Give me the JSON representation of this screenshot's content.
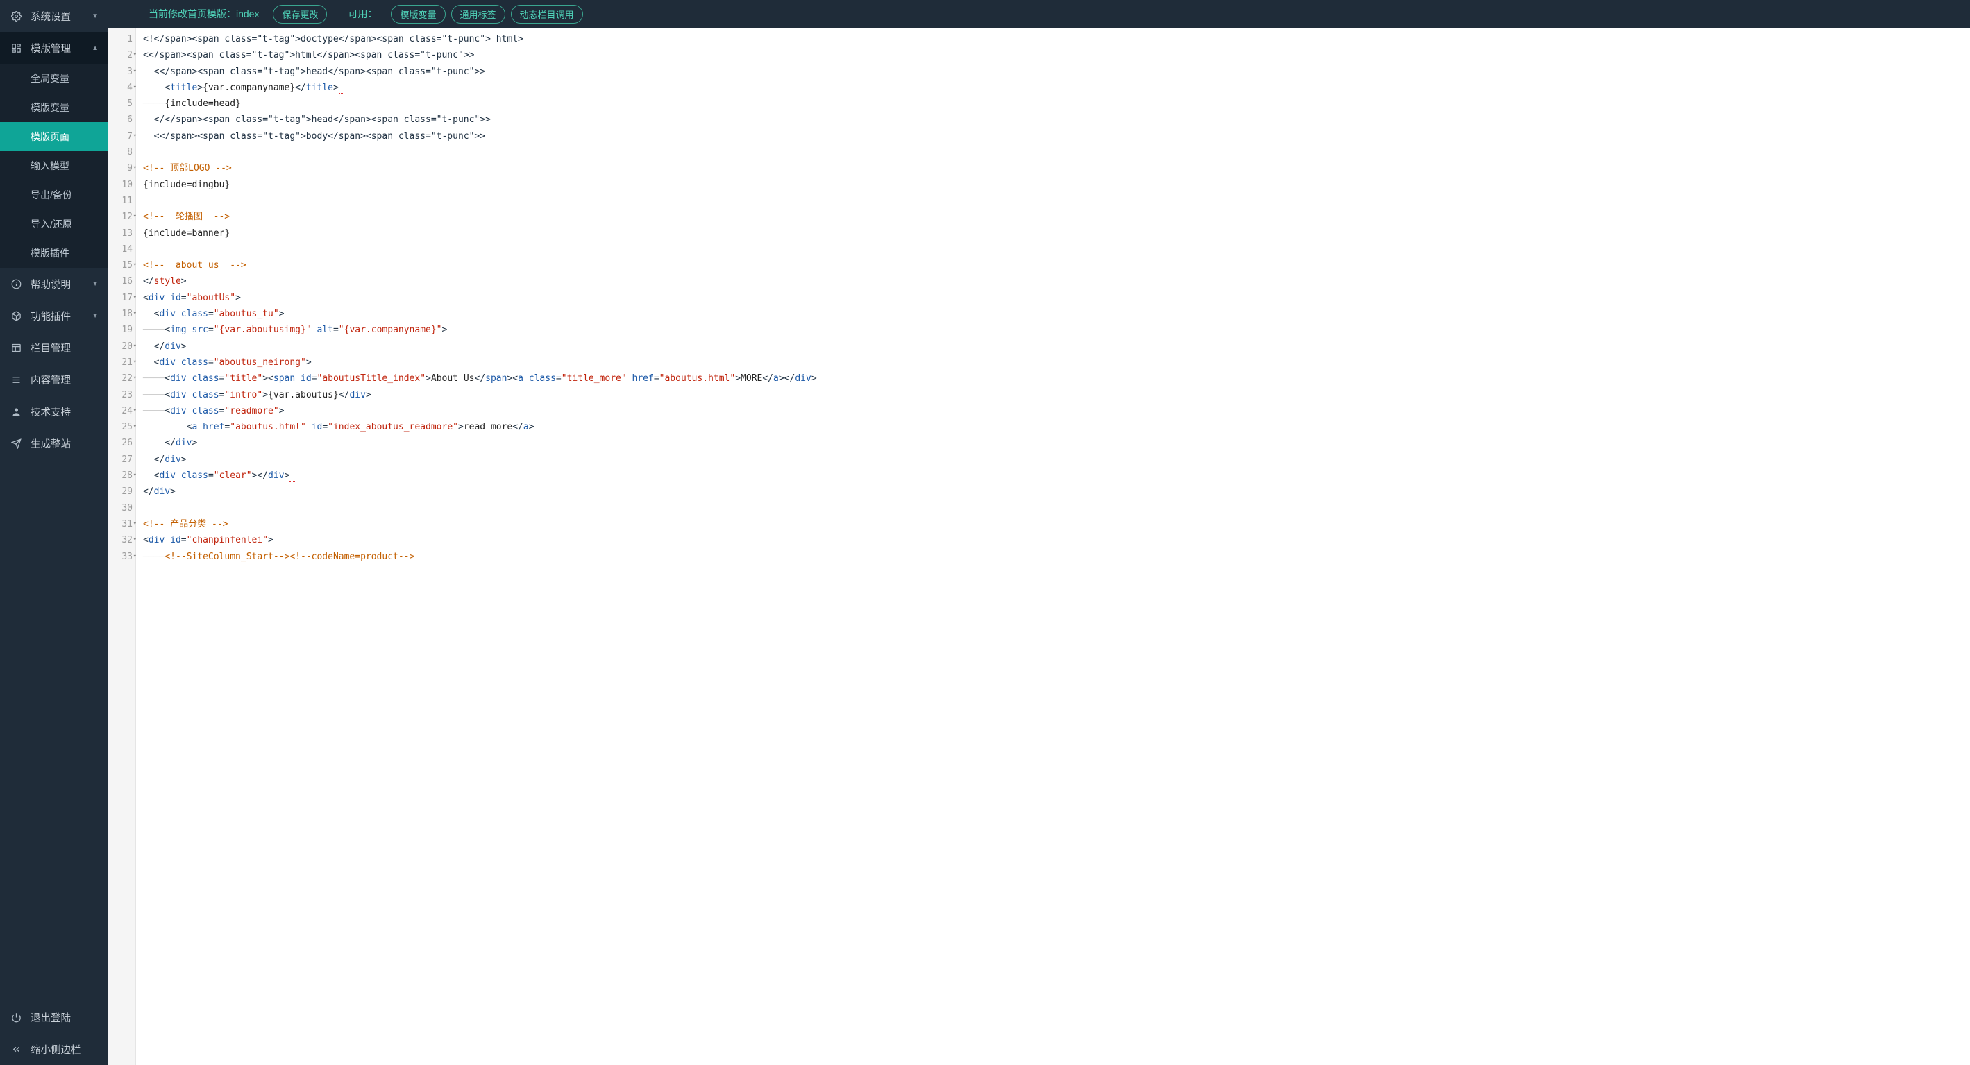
{
  "sidebar": {
    "system_settings": "系统设置",
    "template_manage": "模版管理",
    "help": "帮助说明",
    "plugins": "功能插件",
    "column_manage": "栏目管理",
    "content_manage": "内容管理",
    "tech_support": "技术支持",
    "generate_site": "生成整站",
    "logout": "退出登陆",
    "collapse_sidebar": "缩小侧边栏",
    "sub": {
      "global_vars": "全局变量",
      "template_vars": "模版变量",
      "template_pages": "模版页面",
      "input_model": "输入模型",
      "export_backup": "导出/备份",
      "import_restore": "导入/还原",
      "template_plugins": "模版插件"
    }
  },
  "topbar": {
    "current_label": "当前修改首页模版：index",
    "save_changes": "保存更改",
    "available_label": "可用：",
    "btn_template_vars": "模版变量",
    "btn_general_tags": "通用标签",
    "btn_dynamic_column": "动态栏目调用"
  },
  "code": {
    "line_start": 1,
    "line_end": 33,
    "foldable_lines": [
      2,
      3,
      4,
      7,
      9,
      12,
      15,
      17,
      18,
      20,
      21,
      22,
      24,
      25,
      28,
      31,
      32,
      33
    ],
    "lines": [
      {
        "t": "tag",
        "raw": "<!doctype html>"
      },
      {
        "t": "tag",
        "raw": "<html>"
      },
      {
        "t": "tag",
        "indent": 1,
        "raw": "<head>"
      },
      {
        "t": "title",
        "indent": 2
      },
      {
        "t": "plain",
        "indent": 3,
        "guide": true,
        "raw": "{include=head}"
      },
      {
        "t": "tag",
        "indent": 1,
        "raw": "</head>"
      },
      {
        "t": "tag",
        "indent": 1,
        "raw": "<body>"
      },
      {
        "t": "blank"
      },
      {
        "t": "comment",
        "raw": "<!-- 顶部LOGO -->"
      },
      {
        "t": "plain",
        "raw": "{include=dingbu}"
      },
      {
        "t": "blank"
      },
      {
        "t": "comment",
        "raw": "<!--  轮播图  -->"
      },
      {
        "t": "plain",
        "raw": "{include=banner}"
      },
      {
        "t": "blank"
      },
      {
        "t": "comment",
        "raw": "<!--  about us  -->"
      },
      {
        "t": "closetag_style"
      },
      {
        "t": "div_id",
        "id": "aboutUs"
      },
      {
        "t": "div_class",
        "indent": 1,
        "cls": "aboutus_tu"
      },
      {
        "t": "img_line",
        "indent": 2,
        "guide": true
      },
      {
        "t": "div_close",
        "indent": 1
      },
      {
        "t": "div_class",
        "indent": 1,
        "cls": "aboutus_neirong"
      },
      {
        "t": "aboutus_title",
        "indent": 2,
        "guide": true
      },
      {
        "t": "div_intro",
        "indent": 2,
        "guide": true
      },
      {
        "t": "div_readmore",
        "indent": 2,
        "guide": true
      },
      {
        "t": "a_readmore",
        "indent": 4
      },
      {
        "t": "div_close",
        "indent": 2
      },
      {
        "t": "div_close",
        "indent": 1
      },
      {
        "t": "div_clear",
        "indent": 1
      },
      {
        "t": "div_close",
        "indent": 0
      },
      {
        "t": "blank"
      },
      {
        "t": "comment",
        "raw": "<!-- 产品分类 -->"
      },
      {
        "t": "div_id",
        "id": "chanpinfenlei"
      },
      {
        "t": "sitecolumn",
        "indent": 2,
        "guide": true
      }
    ]
  }
}
